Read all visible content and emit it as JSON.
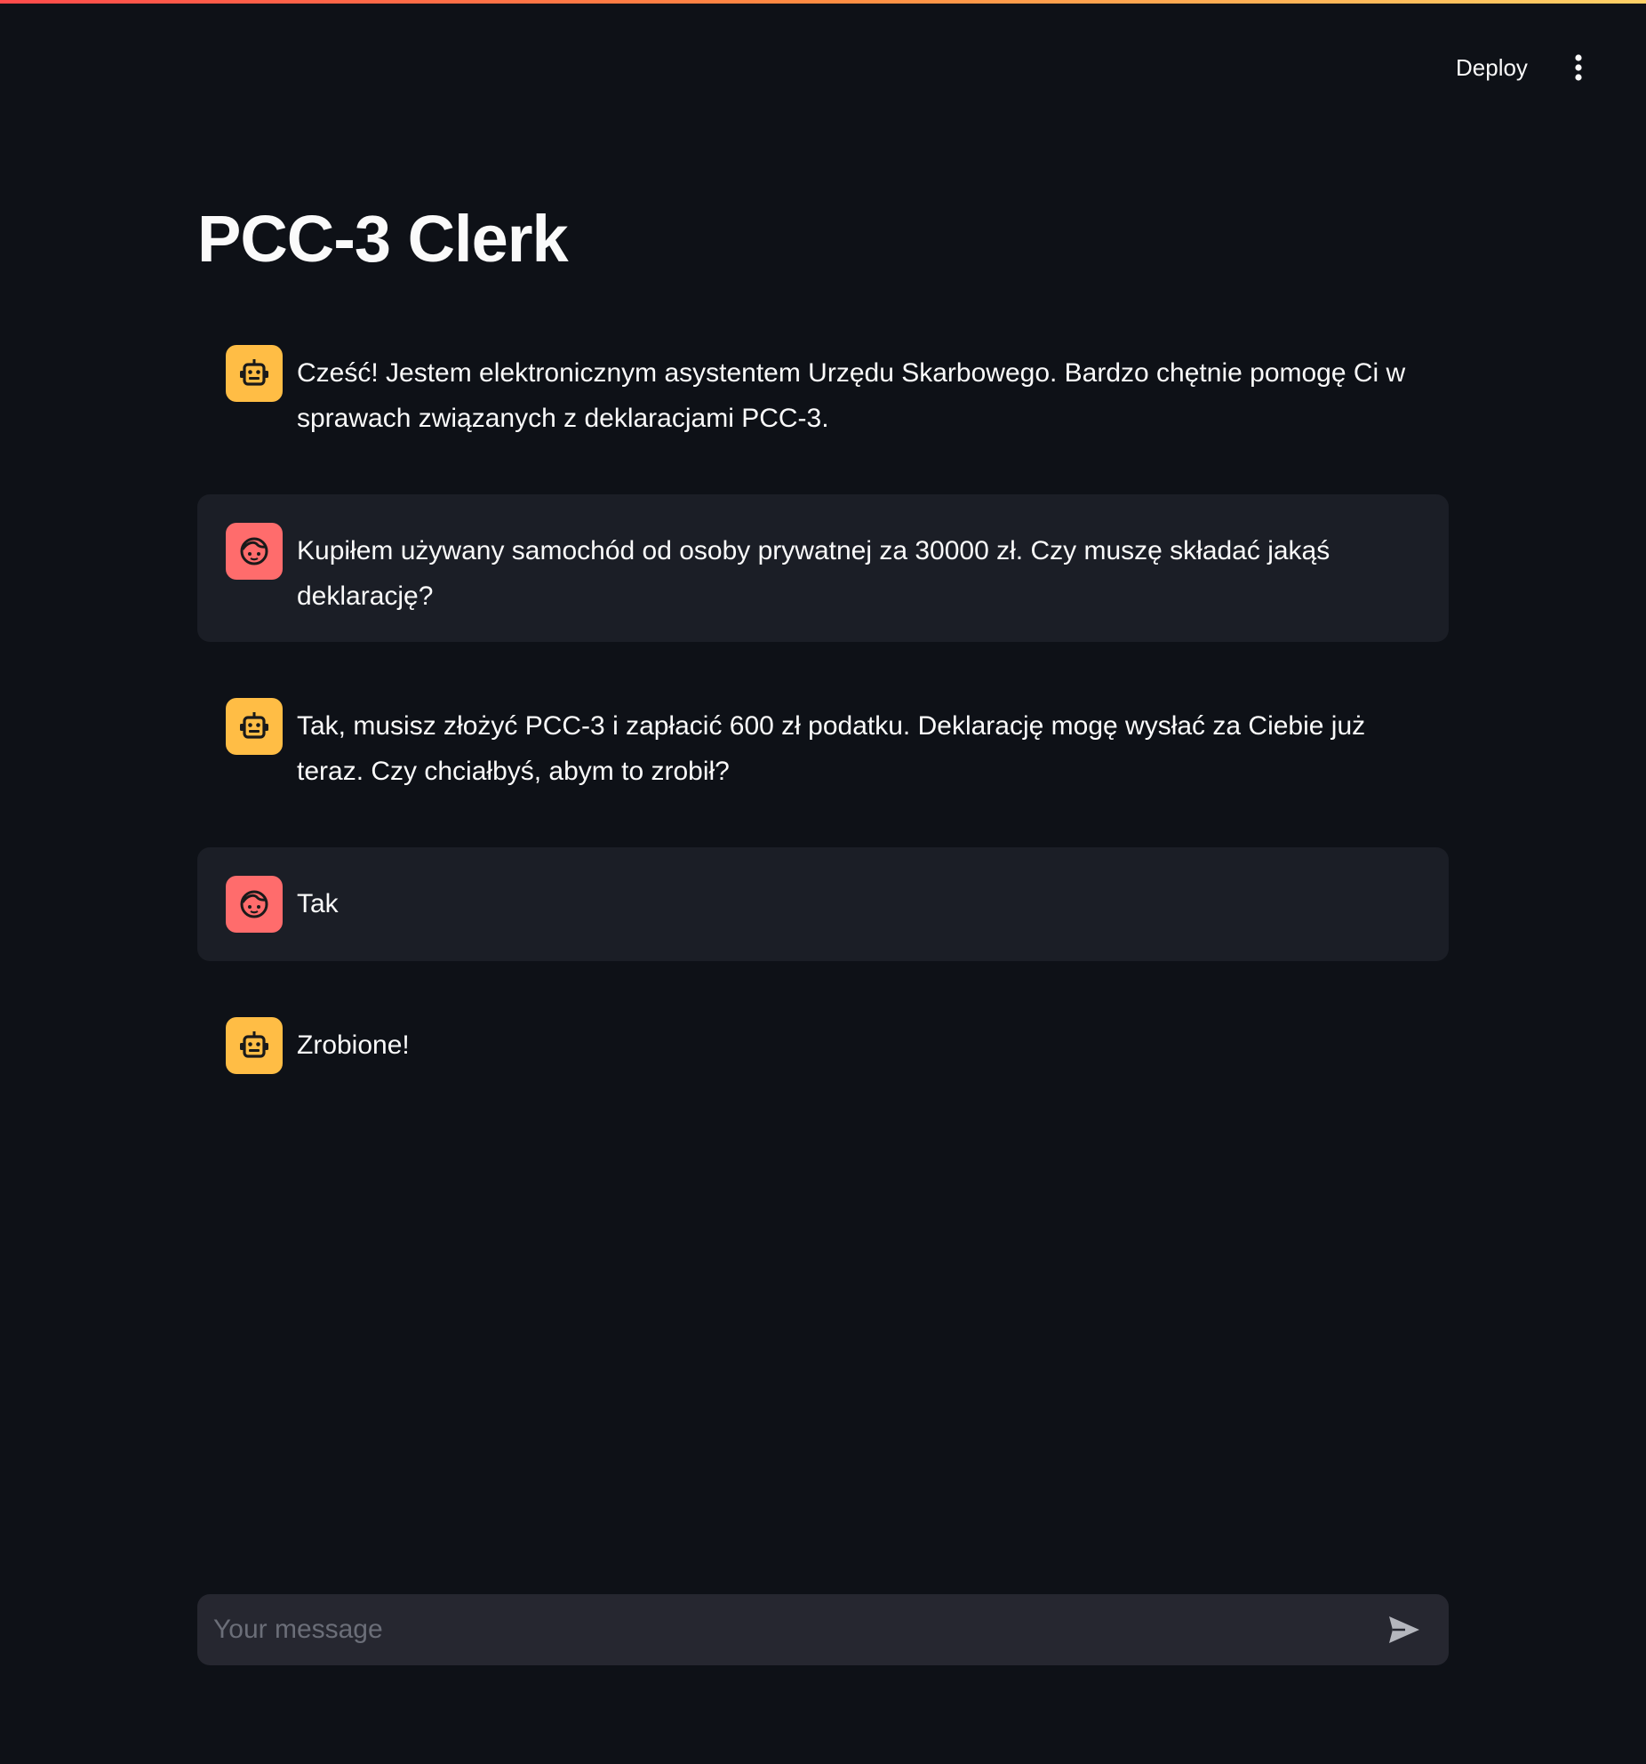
{
  "header": {
    "deploy_label": "Deploy",
    "menu_icon": "more-vertical-icon"
  },
  "page": {
    "title": "PCC-3 Clerk"
  },
  "colors": {
    "background": "#0e1117",
    "user_message_bg": "#1b1e26",
    "assistant_avatar": "#ffbd45",
    "user_avatar": "#ff6c6c",
    "input_bg": "#262730"
  },
  "messages": [
    {
      "role": "assistant",
      "icon": "robot-icon",
      "text": "Cześć! Jestem elektronicznym asystentem Urzędu Skarbowego. Bardzo chętnie pomogę Ci w sprawach związanych z deklaracjami PCC-3."
    },
    {
      "role": "user",
      "icon": "face-icon",
      "text": "Kupiłem używany samochód od osoby prywatnej za 30000 zł. Czy muszę składać jakąś deklarację?"
    },
    {
      "role": "assistant",
      "icon": "robot-icon",
      "text": "Tak, musisz złożyć PCC-3 i zapłacić 600 zł podatku. Deklarację mogę wysłać za Ciebie już teraz. Czy chciałbyś, abym to zrobił?"
    },
    {
      "role": "user",
      "icon": "face-icon",
      "text": "Tak"
    },
    {
      "role": "assistant",
      "icon": "robot-icon",
      "text": "Zrobione!"
    }
  ],
  "chat_input": {
    "placeholder": "Your message",
    "value": "",
    "send_icon": "send-icon"
  }
}
